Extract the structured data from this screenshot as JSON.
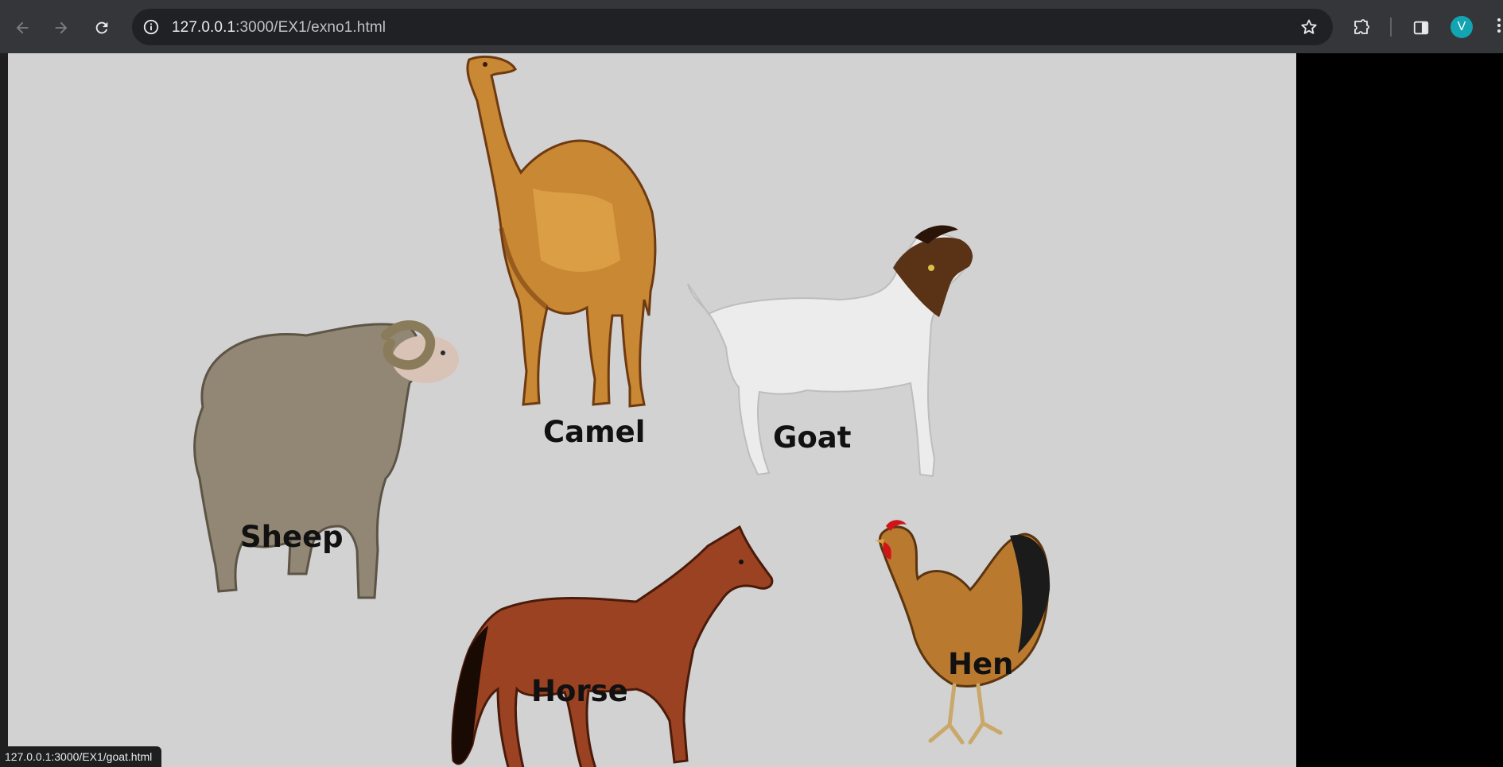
{
  "browser": {
    "url_host": "127.0.0.1",
    "url_rest": ":3000/EX1/exno1.html",
    "profile_initial": "V",
    "status_url": "127.0.0.1:3000/EX1/goat.html"
  },
  "icons": {
    "back": "arrow-left-icon",
    "forward": "arrow-right-icon",
    "reload": "reload-icon",
    "site_info": "info-icon",
    "bookmark": "star-icon",
    "extensions": "puzzle-icon",
    "side_panel": "side-panel-icon",
    "menu": "three-dots-icon"
  },
  "colors": {
    "page_background": "#d2d2d2",
    "avatar": "#12a4b0"
  },
  "animals": {
    "camel": "Camel",
    "goat": "Goat",
    "sheep": "Sheep",
    "horse": "Horse",
    "hen": "Hen"
  }
}
